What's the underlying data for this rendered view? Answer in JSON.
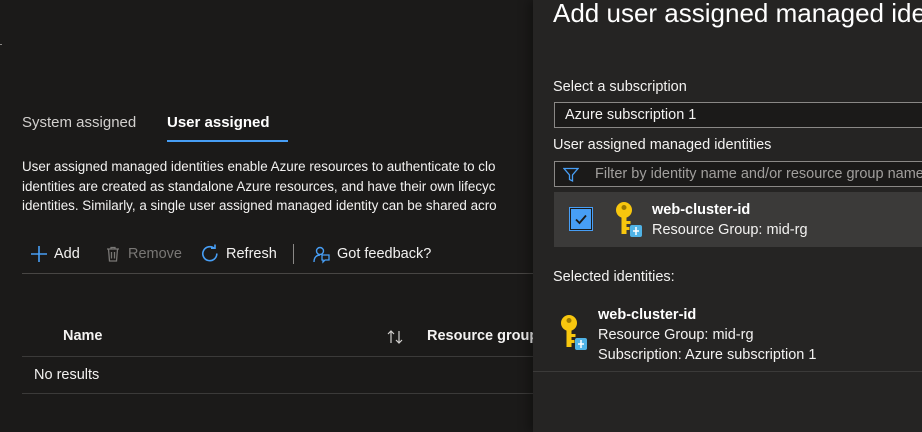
{
  "tabs": [
    {
      "label": "System assigned",
      "selected": false
    },
    {
      "label": "User assigned",
      "selected": true
    }
  ],
  "description": {
    "lines": [
      "User assigned managed identities enable Azure resources to authenticate to clo",
      "identities are created as standalone Azure resources, and have their own lifecyc",
      "identities. Similarly, a single user assigned managed identity can be shared acro"
    ]
  },
  "toolbar": {
    "add_label": "Add",
    "remove_label": "Remove",
    "refresh_label": "Refresh",
    "feedback_label": "Got feedback?"
  },
  "grid": {
    "columns": [
      "Name",
      "Resource group"
    ],
    "empty_text": "No results"
  },
  "panel": {
    "title": "Add user assigned managed identity",
    "subscription_label": "Select a subscription",
    "subscription_value": "Azure subscription 1",
    "identities_label": "User assigned managed identities",
    "filter_placeholder": "Filter by identity name and/or resource group name",
    "identities": [
      {
        "name": "web-cluster-id",
        "resource_group": "Resource Group: mid-rg",
        "checked": true
      }
    ],
    "selected_label": "Selected identities:",
    "selected": [
      {
        "name": "web-cluster-id",
        "resource_group": "Resource Group: mid-rg",
        "subscription": "Subscription: Azure subscription 1"
      }
    ]
  },
  "colors": {
    "accent": "#479ef5",
    "key_icon": "#f8c70e",
    "background": "#1b1a19",
    "panel": "#252423"
  }
}
